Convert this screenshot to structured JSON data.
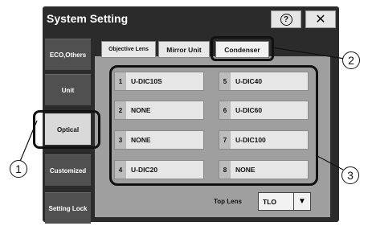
{
  "window": {
    "title": "System Setting",
    "help_glyph": "?",
    "close_glyph": "✕"
  },
  "sidebar": {
    "items": [
      {
        "label": "ECO,Others"
      },
      {
        "label": "Unit"
      },
      {
        "label": "Optical"
      },
      {
        "label": "Customized"
      },
      {
        "label": "Setting Lock"
      }
    ]
  },
  "tabs": [
    {
      "label": "Objective Lens"
    },
    {
      "label": "Mirror Unit"
    },
    {
      "label": "Condenser"
    }
  ],
  "lenses": [
    {
      "num": "1",
      "name": "U-DIC10S"
    },
    {
      "num": "2",
      "name": "NONE"
    },
    {
      "num": "3",
      "name": "NONE"
    },
    {
      "num": "4",
      "name": "U-DIC20"
    },
    {
      "num": "5",
      "name": "U-DIC40"
    },
    {
      "num": "6",
      "name": "U-DIC60"
    },
    {
      "num": "7",
      "name": "U-DIC100"
    },
    {
      "num": "8",
      "name": "NONE"
    }
  ],
  "top_lens": {
    "label": "Top Lens",
    "value": "TLO",
    "arrow": "▼"
  },
  "callouts": {
    "one": "1",
    "two": "2",
    "three": "3"
  }
}
